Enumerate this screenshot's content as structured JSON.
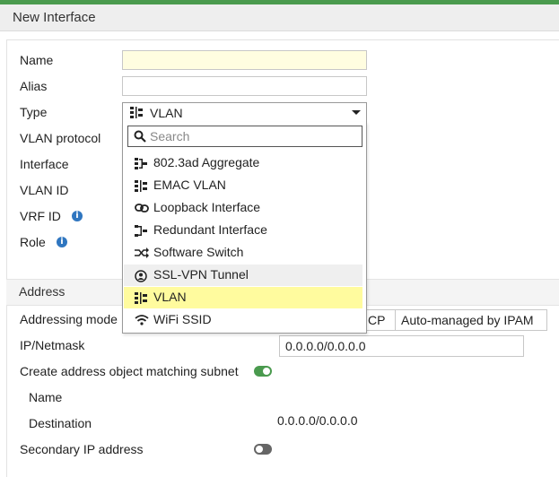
{
  "window": {
    "title": "New Interface"
  },
  "form": {
    "name_label": "Name",
    "name_value": "",
    "alias_label": "Alias",
    "alias_value": "",
    "type_label": "Type",
    "vlan_protocol_label": "VLAN protocol",
    "interface_label": "Interface",
    "vlan_id_label": "VLAN ID",
    "vrf_id_label": "VRF ID",
    "role_label": "Role"
  },
  "type_select": {
    "selected": "VLAN",
    "search_placeholder": "Search",
    "options": [
      {
        "label": "802.3ad Aggregate",
        "icon": "aggregate-icon"
      },
      {
        "label": "EMAC VLAN",
        "icon": "vlan-icon"
      },
      {
        "label": "Loopback Interface",
        "icon": "loopback-icon"
      },
      {
        "label": "Redundant Interface",
        "icon": "redundant-icon"
      },
      {
        "label": "Software Switch",
        "icon": "switch-icon"
      },
      {
        "label": "SSL-VPN Tunnel",
        "icon": "ssl-vpn-icon"
      },
      {
        "label": "VLAN",
        "icon": "vlan-icon"
      },
      {
        "label": "WiFi SSID",
        "icon": "wifi-icon"
      }
    ],
    "hovered_option": "SSL-VPN Tunnel"
  },
  "address": {
    "section_title": "Address",
    "addressing_mode_label": "Addressing mode",
    "mode_partial": "CP",
    "mode_ipam": "Auto-managed by IPAM",
    "ip_netmask_label": "IP/Netmask",
    "ip_netmask_value": "0.0.0.0/0.0.0.0",
    "create_object_label": "Create address object matching subnet",
    "create_object_enabled": true,
    "name_label": "Name",
    "destination_label": "Destination",
    "destination_value": "0.0.0.0/0.0.0.0",
    "secondary_ip_label": "Secondary IP address",
    "secondary_ip_enabled": false
  },
  "colors": {
    "accent_green": "#4a9a4e",
    "info_blue": "#2f76c0",
    "selected_yellow": "#fffb9e",
    "required_field": "#fffde0"
  }
}
